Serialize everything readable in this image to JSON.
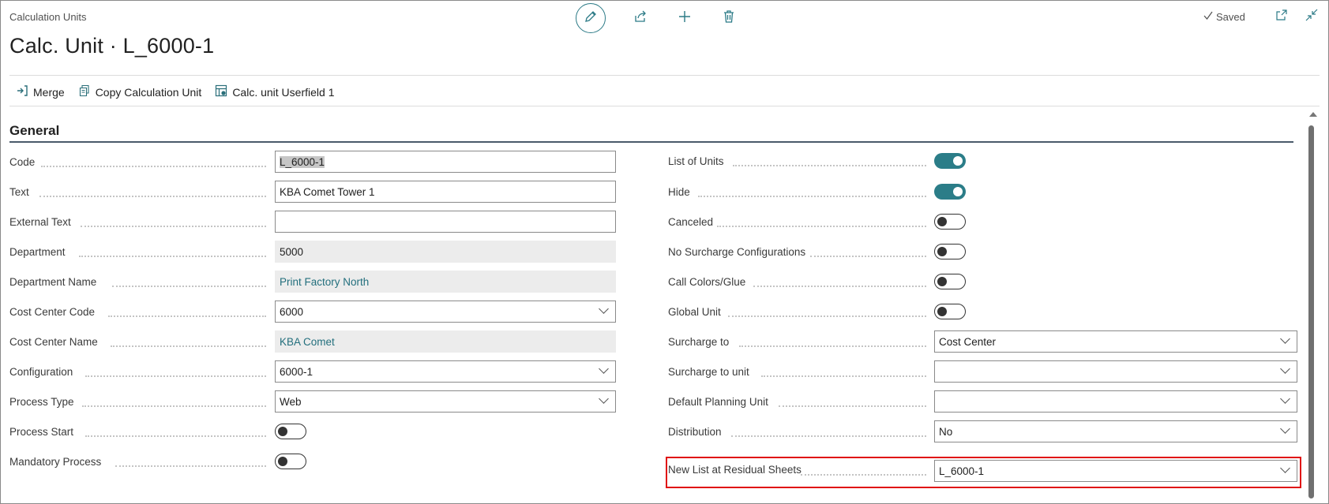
{
  "header": {
    "breadcrumb": "Calculation Units",
    "title": "Calc. Unit · L_6000-1",
    "saved_label": "Saved"
  },
  "top_actions": [
    "edit-icon",
    "share-icon",
    "plus-icon",
    "trash-icon"
  ],
  "window_actions": [
    "open-in-new-window-icon",
    "collapse-icon"
  ],
  "actionbar": {
    "merge": "Merge",
    "copy_unit": "Copy Calculation Unit",
    "userfield": "Calc. unit Userfield 1"
  },
  "section": {
    "title": "General"
  },
  "left_fields": {
    "code": {
      "label": "Code",
      "value": "L_6000-1"
    },
    "text": {
      "label": "Text",
      "value": "KBA Comet Tower 1"
    },
    "external_text": {
      "label": "External Text",
      "value": ""
    },
    "department": {
      "label": "Department",
      "value": "5000"
    },
    "department_name": {
      "label": "Department Name",
      "value": "Print Factory North"
    },
    "cost_center_code": {
      "label": "Cost Center Code",
      "value": "6000"
    },
    "cost_center_name": {
      "label": "Cost Center Name",
      "value": "KBA Comet"
    },
    "configuration": {
      "label": "Configuration",
      "value": "6000-1"
    },
    "process_type": {
      "label": "Process Type",
      "value": "Web"
    },
    "process_start": {
      "label": "Process Start",
      "value": false
    },
    "mandatory_process": {
      "label": "Mandatory Process",
      "value": false
    }
  },
  "right_fields": {
    "list_of_units": {
      "label": "List of Units",
      "value": true
    },
    "hide": {
      "label": "Hide",
      "value": true
    },
    "canceled": {
      "label": "Canceled",
      "value": false
    },
    "no_surcharge": {
      "label": "No Surcharge Configurations",
      "value": false
    },
    "call_colors": {
      "label": "Call Colors/Glue",
      "value": false
    },
    "global_unit": {
      "label": "Global Unit",
      "value": false
    },
    "surcharge_to": {
      "label": "Surcharge to",
      "value": "Cost Center"
    },
    "surcharge_to_unit": {
      "label": "Surcharge to unit",
      "value": ""
    },
    "default_planning_unit": {
      "label": "Default Planning Unit",
      "value": ""
    },
    "distribution": {
      "label": "Distribution",
      "value": "No"
    },
    "new_list_residual": {
      "label": "New List at Residual Sheets",
      "value": "L_6000-1"
    }
  },
  "colors": {
    "accent": "#2b7d88",
    "highlight": "#e01010",
    "link": "#236f7d"
  }
}
